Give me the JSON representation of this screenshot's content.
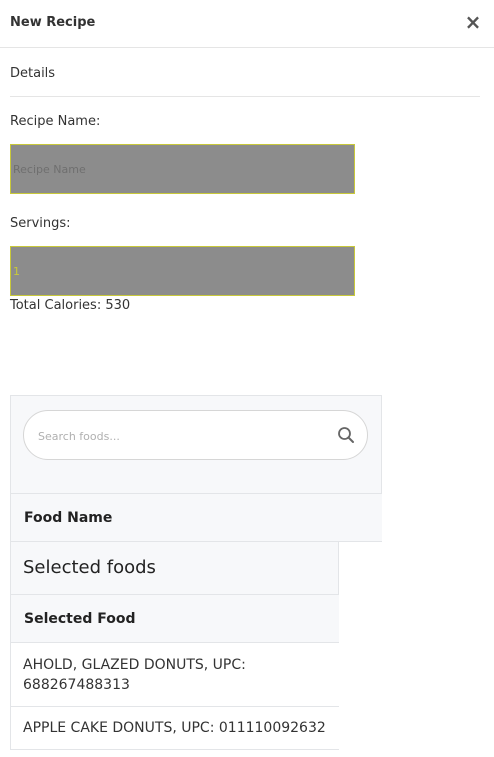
{
  "dialog": {
    "title": "New Recipe",
    "close_symbol": "×"
  },
  "details": {
    "label": "Details"
  },
  "recipe_name": {
    "label": "Recipe Name:",
    "placeholder": "Recipe Name",
    "value": ""
  },
  "servings": {
    "label": "Servings:",
    "value": "1"
  },
  "total_calories": "Total Calories: 530",
  "search": {
    "placeholder": "Search foods...",
    "icon": "search-icon"
  },
  "food_table": {
    "header": "Food Name"
  },
  "selected": {
    "title": "Selected foods",
    "header": "Selected Food",
    "items": [
      "AHOLD, GLAZED DONUTS, UPC: 688267488313",
      "APPLE CAKE DONUTS, UPC: 011110092632"
    ]
  }
}
